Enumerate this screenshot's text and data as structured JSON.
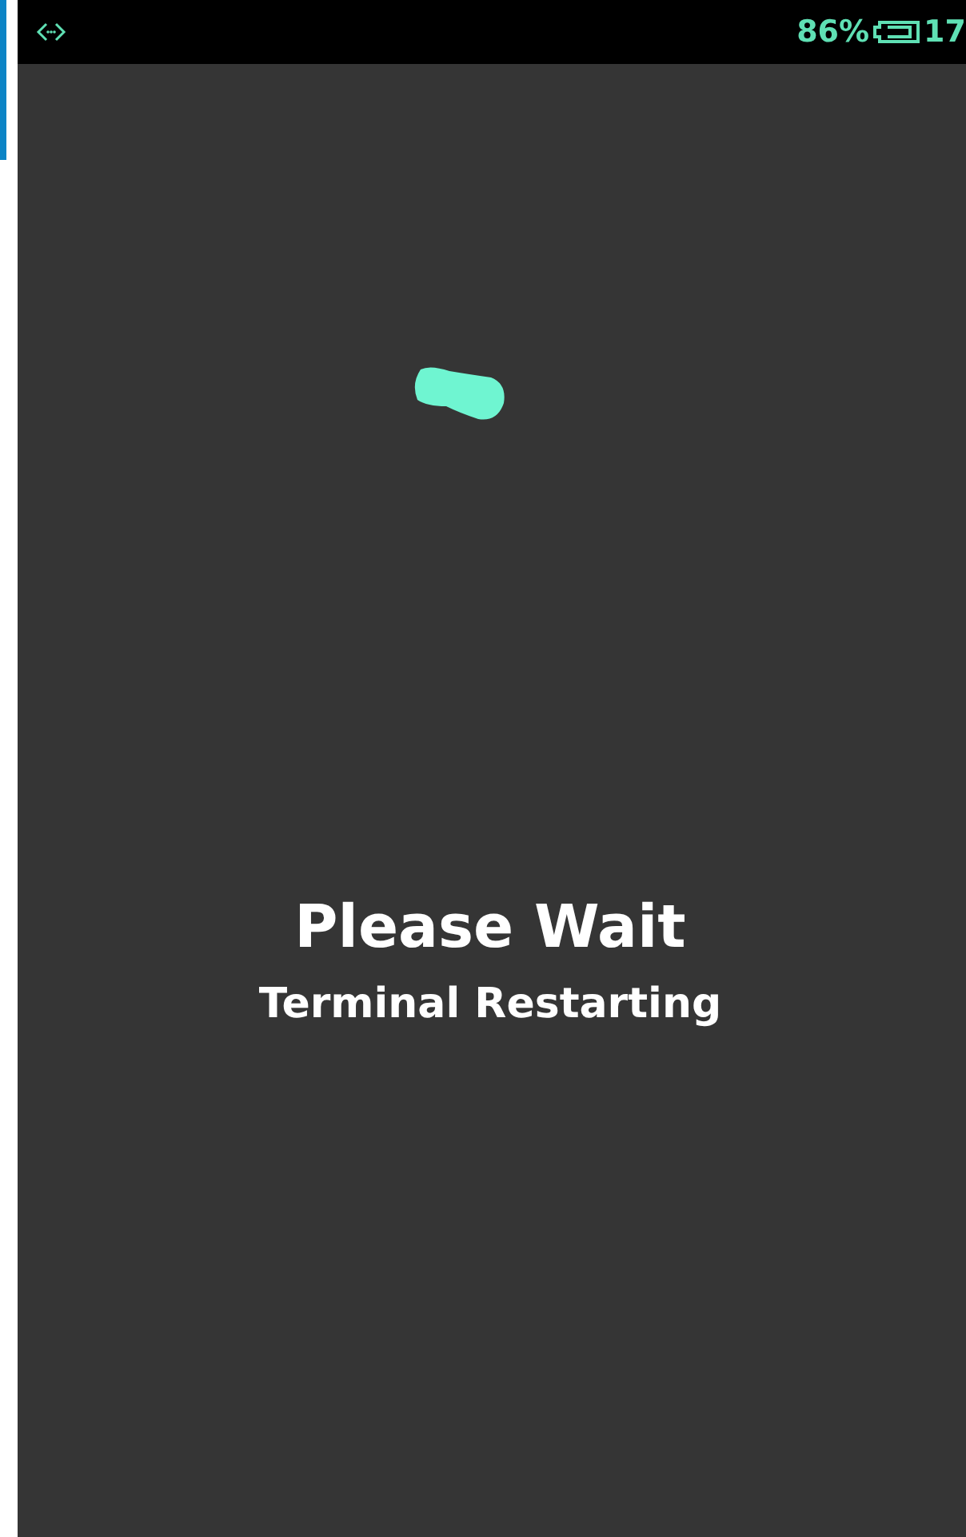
{
  "status_bar": {
    "battery": "86%",
    "time": "17"
  },
  "message": {
    "title": "Please Wait",
    "subtitle": "Terminal Restarting"
  }
}
